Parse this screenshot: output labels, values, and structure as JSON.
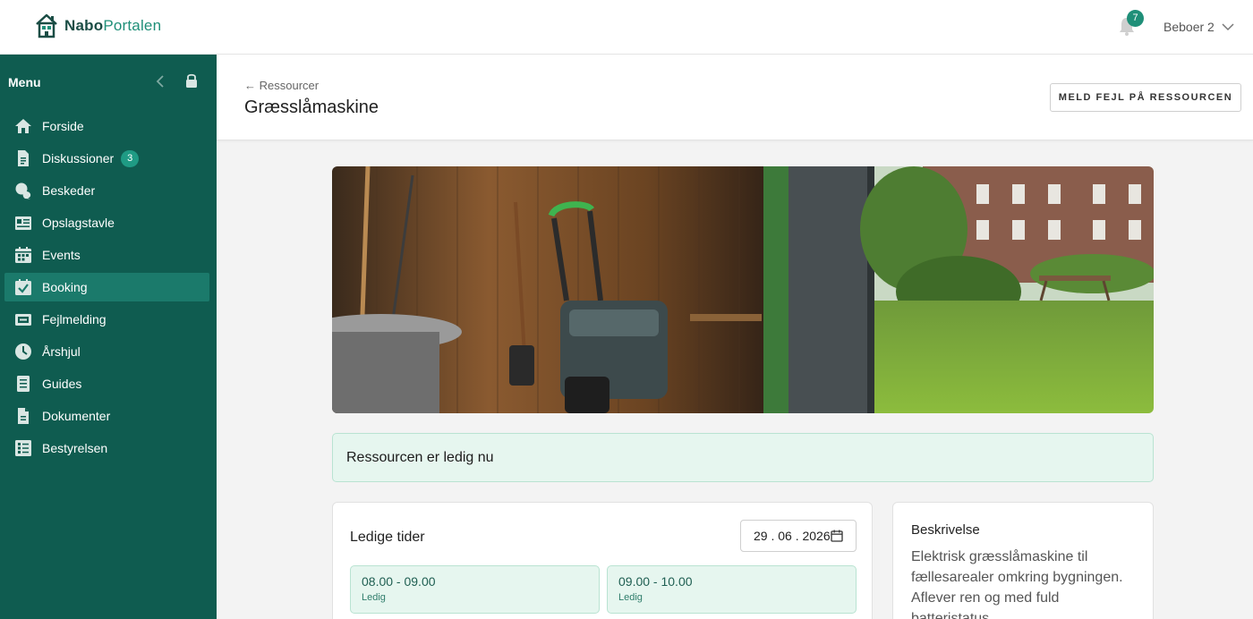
{
  "app": {
    "logo_part1": "Nabo",
    "logo_part2": "Portalen",
    "notifications_count": "7",
    "user_name": "Beboer 2"
  },
  "sidebar": {
    "title": "Menu",
    "items": [
      {
        "label": "Forside",
        "icon": "house-icon"
      },
      {
        "label": "Diskussioner",
        "icon": "document-icon",
        "badge": "3"
      },
      {
        "label": "Beskeder",
        "icon": "chat-icon"
      },
      {
        "label": "Opslagstavle",
        "icon": "bulletin-board-icon"
      },
      {
        "label": "Events",
        "icon": "calendar-icon"
      },
      {
        "label": "Booking",
        "icon": "calendar-check-icon",
        "active": true
      },
      {
        "label": "Fejlmelding",
        "icon": "alert-card-icon"
      },
      {
        "label": "Årshjul",
        "icon": "clock-icon"
      },
      {
        "label": "Guides",
        "icon": "list-document-icon"
      },
      {
        "label": "Dokumenter",
        "icon": "file-icon"
      },
      {
        "label": "Bestyrelsen",
        "icon": "table-icon"
      }
    ]
  },
  "header": {
    "back_label": "← Ressourcer",
    "title": "Græsslåmaskine",
    "report_button": "MELD FEJL PÅ RESSOURCEN"
  },
  "status": {
    "text": "Ressourcen er ledig nu"
  },
  "slots": {
    "title": "Ledige tider",
    "date_value": "29 . 06 . 2026",
    "items": [
      {
        "time": "08.00 - 09.00",
        "status": "Ledig"
      },
      {
        "time": "09.00 - 10.00",
        "status": "Ledig"
      }
    ]
  },
  "description": {
    "title": "Beskrivelse",
    "text": "Elektrisk græsslåmaskine til fællesarealer omkring bygningen. Aflever ren og med fuld batteristatus."
  },
  "colors": {
    "sidebar": "#0f5c50",
    "active": "#1b7a6b",
    "accent": "#1f8f78",
    "status_bg": "#e6f6ef"
  }
}
